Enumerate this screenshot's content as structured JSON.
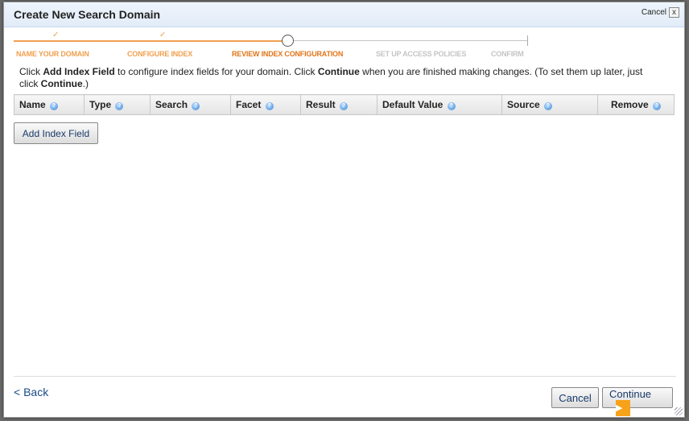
{
  "dialog": {
    "title": "Create New Search Domain",
    "close_label": "Cancel",
    "close_icon": "x"
  },
  "wizard": {
    "steps": [
      {
        "label": "NAME YOUR DOMAIN",
        "state": "done"
      },
      {
        "label": "CONFIGURE INDEX",
        "state": "done"
      },
      {
        "label": "REVIEW INDEX CONFIGURATION",
        "state": "current"
      },
      {
        "label": "SET UP ACCESS POLICIES",
        "state": "pending"
      },
      {
        "label": "CONFIRM",
        "state": "pending"
      }
    ]
  },
  "intro": {
    "p1": "Click ",
    "b1": "Add Index Field",
    "p2": " to configure index fields for your domain. Click ",
    "b2": "Continue",
    "p3": " when you are finished making changes. (To set them up later, just click ",
    "b3": "Continue",
    "p4": ".)"
  },
  "table": {
    "columns": [
      "Name",
      "Type",
      "Search",
      "Facet",
      "Result",
      "Default Value",
      "Source",
      "Remove"
    ]
  },
  "add_button": "Add Index Field",
  "footer": {
    "back": "< Back",
    "cancel": "Cancel",
    "continue": "Continue"
  },
  "colors": {
    "accent": "#f7a21b",
    "done": "#f0a050",
    "current": "#e0761a",
    "pending": "#c4c4c4"
  }
}
